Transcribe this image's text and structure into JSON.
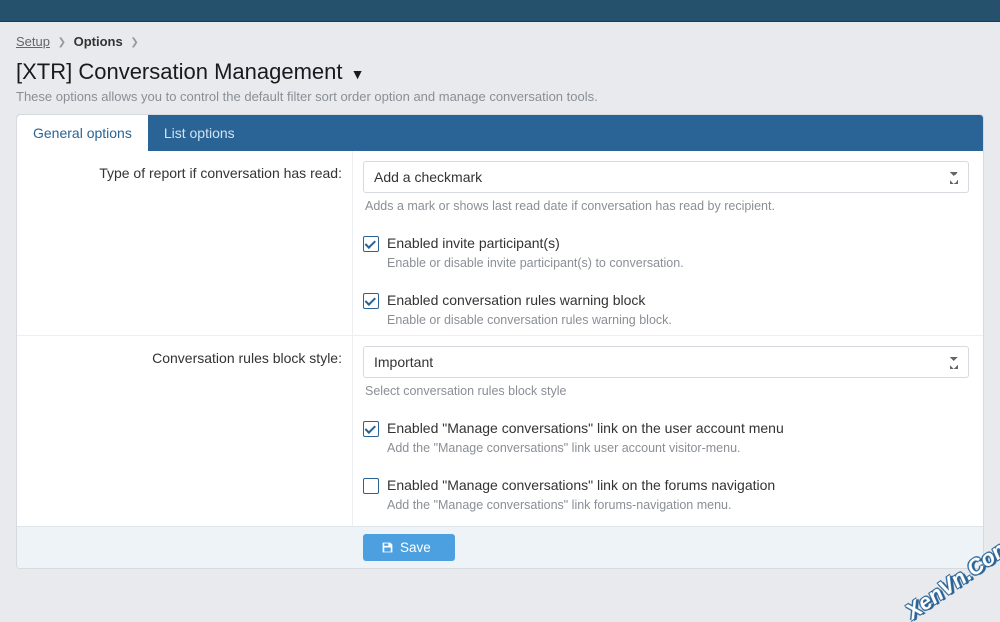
{
  "breadcrumb": {
    "setup": "Setup",
    "options": "Options"
  },
  "page": {
    "title": "[XTR] Conversation Management",
    "description": "These options allows you to control the default filter sort order option and manage conversation tools."
  },
  "tabs": {
    "general": "General options",
    "list": "List options"
  },
  "fields": {
    "report_type": {
      "label": "Type of report if conversation has read:",
      "value": "Add a checkmark",
      "hint": "Adds a mark or shows last read date if conversation has read by recipient."
    },
    "invite": {
      "label": "Enabled invite participant(s)",
      "hint": "Enable or disable invite participant(s) to conversation.",
      "checked": true
    },
    "rules_block": {
      "label": "Enabled conversation rules warning block",
      "hint": "Enable or disable conversation rules warning block.",
      "checked": true
    },
    "block_style": {
      "label": "Conversation rules block style:",
      "value": "Important",
      "hint": "Select conversation rules block style"
    },
    "manage_account": {
      "label": "Enabled \"Manage conversations\" link on the user account menu",
      "hint": "Add the \"Manage conversations\" link user account visitor-menu.",
      "checked": true
    },
    "manage_nav": {
      "label": "Enabled \"Manage conversations\" link on the forums navigation",
      "hint": "Add the \"Manage conversations\" link forums-navigation menu.",
      "checked": false
    }
  },
  "footer": {
    "save": "Save"
  },
  "watermark": "XenVn.Com"
}
